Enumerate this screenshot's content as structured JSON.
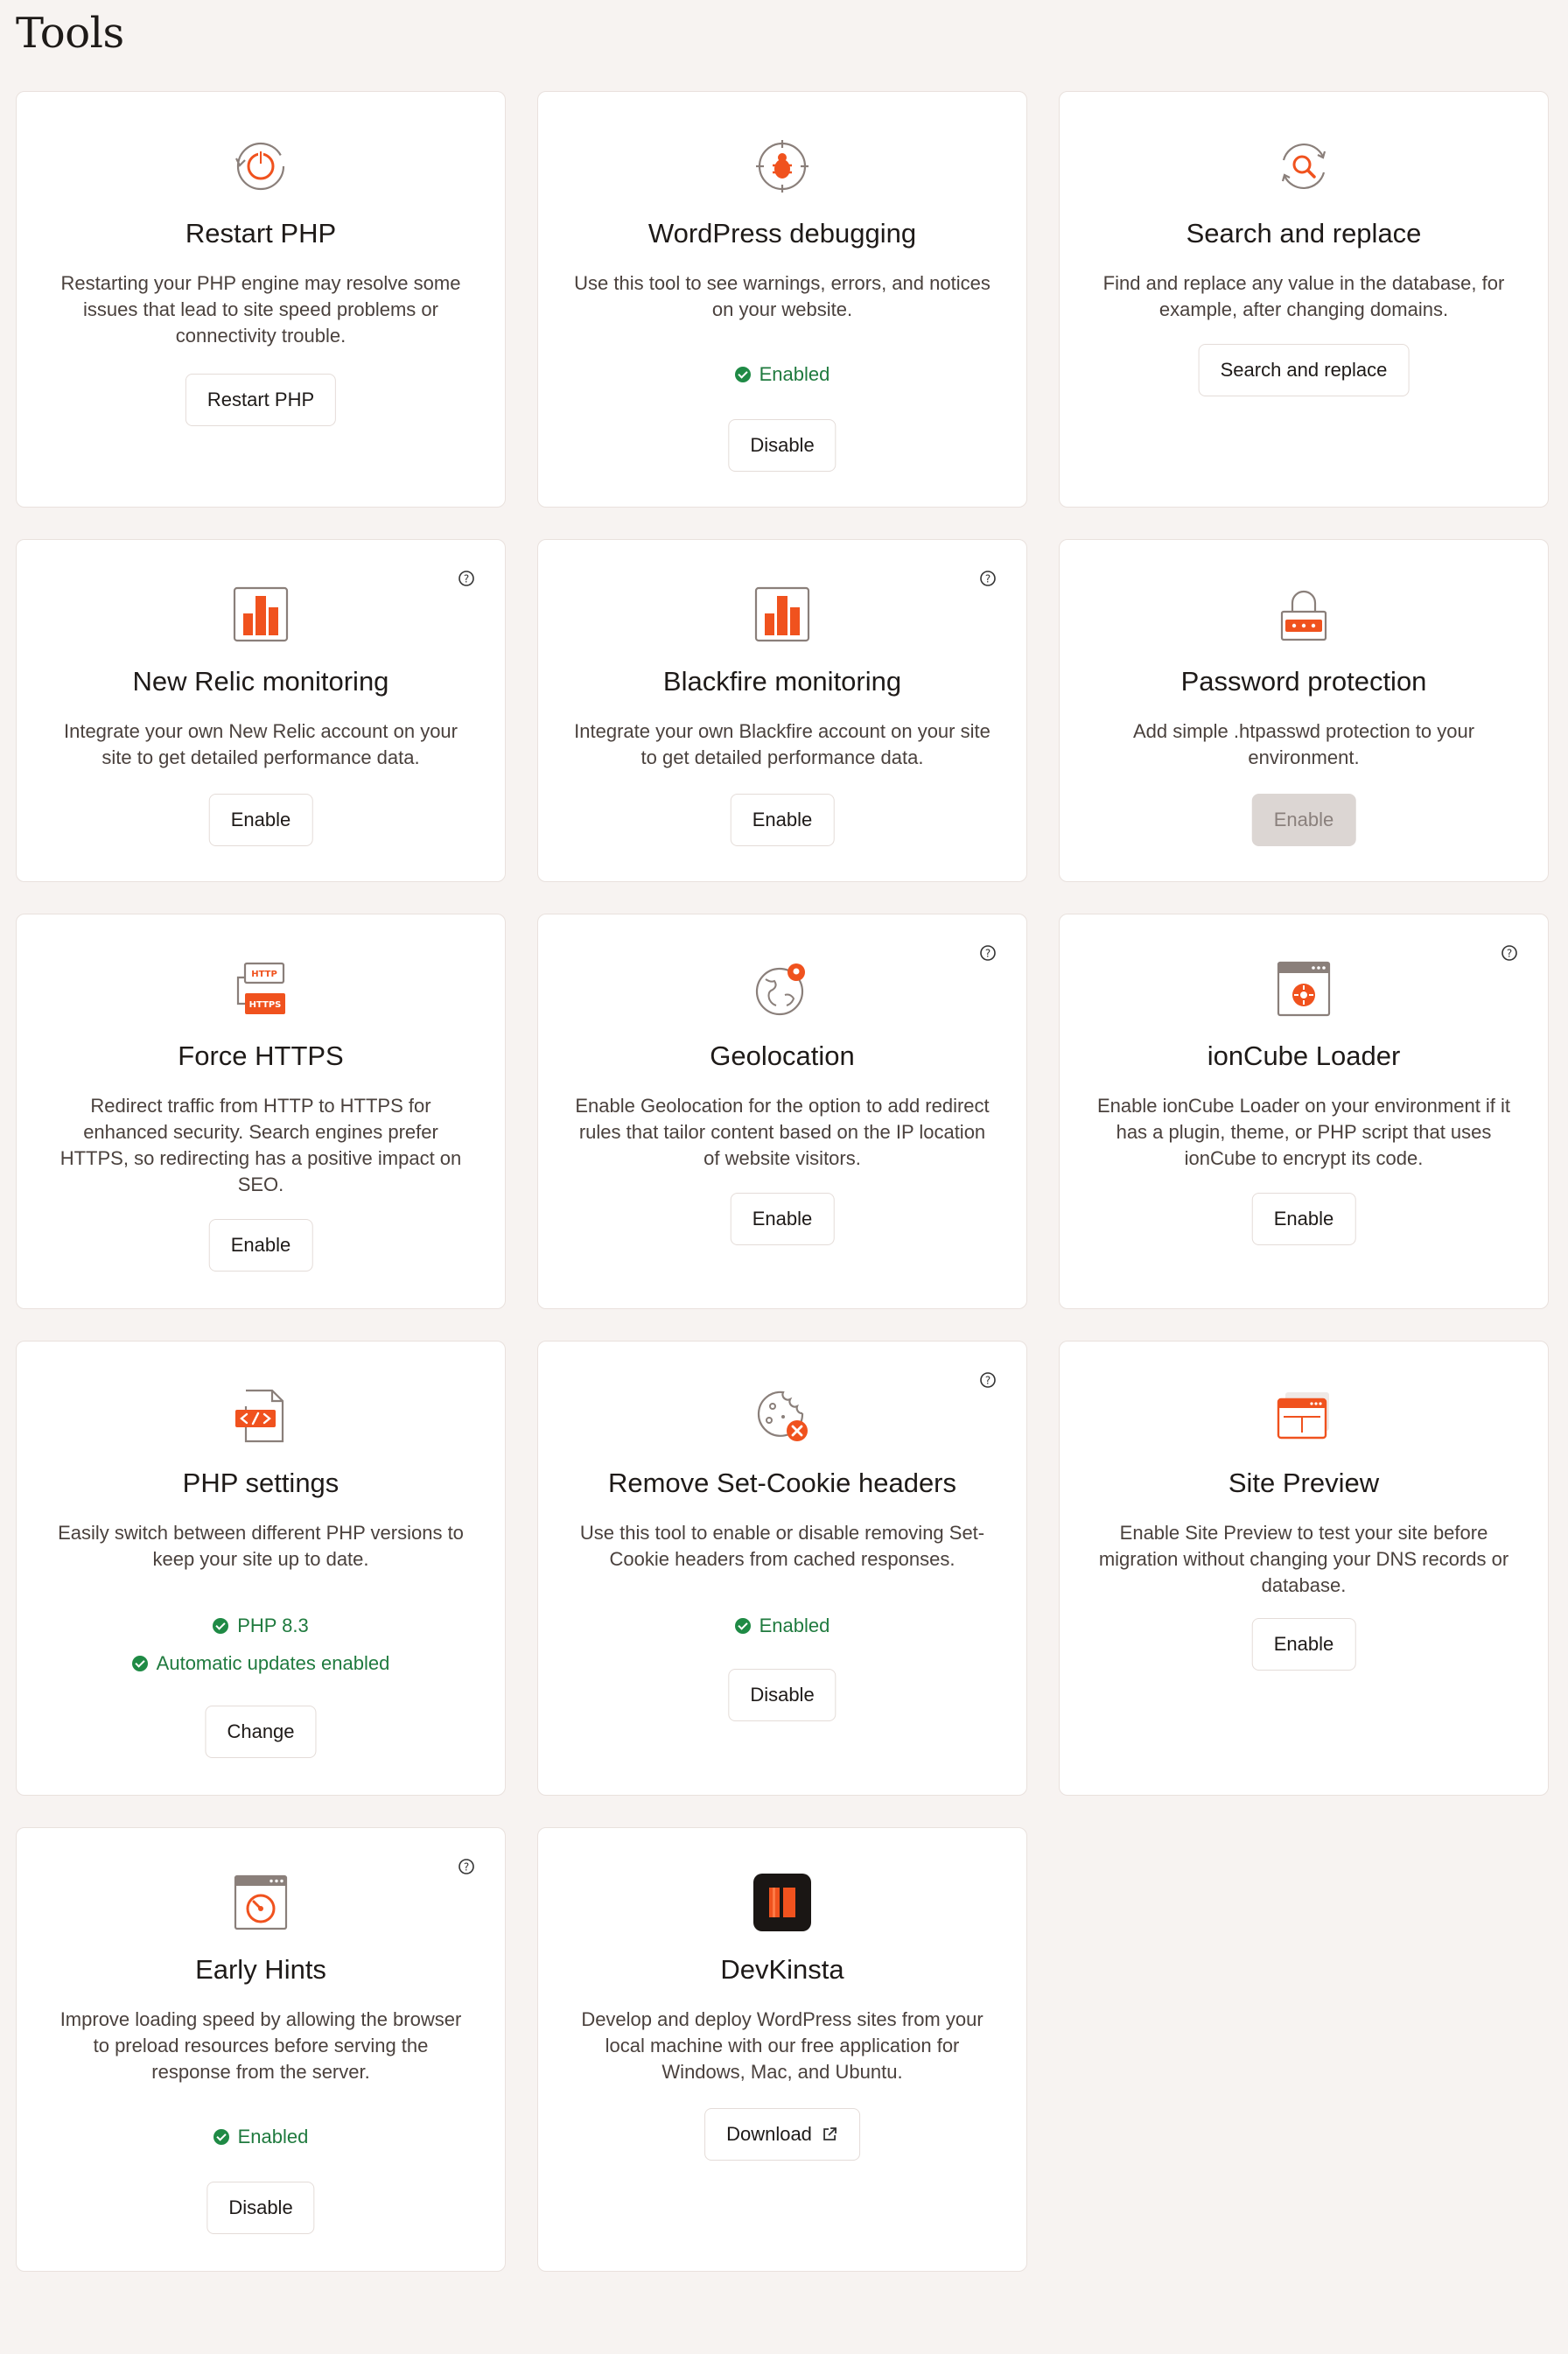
{
  "page": {
    "title": "Tools"
  },
  "colors": {
    "accent": "#f0521e",
    "success": "#1f8a45",
    "border": "#e9e1dd",
    "background": "#f7f3f1"
  },
  "cards": [
    {
      "title": "Restart PHP",
      "icon": "restart-power-icon",
      "description": "Restarting your PHP engine may resolve some issues that lead to site speed problems or connectivity trouble.",
      "button": "Restart PHP"
    },
    {
      "title": "WordPress debugging",
      "icon": "bug-icon",
      "description": "Use this tool to see warnings, errors, and notices on your website.",
      "status": [
        "Enabled"
      ],
      "button": "Disable"
    },
    {
      "title": "Search and replace",
      "icon": "search-replace-icon",
      "description": "Find and replace any value in the database, for example, after changing domains.",
      "button": "Search and replace"
    },
    {
      "title": "New Relic monitoring",
      "icon": "bar-chart-icon",
      "description": "Integrate your own New Relic account on your site to get detailed performance data.",
      "button": "Enable",
      "help": true
    },
    {
      "title": "Blackfire monitoring",
      "icon": "bar-chart-icon",
      "description": "Integrate your own Blackfire account on your site to get detailed performance data.",
      "button": "Enable",
      "help": true
    },
    {
      "title": "Password protection",
      "icon": "lock-icon",
      "description": "Add simple .htpasswd protection to your environment.",
      "button": "Enable",
      "disabled": true
    },
    {
      "title": "Force HTTPS",
      "icon": "https-icon",
      "icon_text": {
        "http": "HTTP",
        "https": "HTTPS"
      },
      "description": "Redirect traffic from HTTP to HTTPS for enhanced security. Search engines prefer HTTPS, so redirecting has a positive impact on SEO.",
      "button": "Enable"
    },
    {
      "title": "Geolocation",
      "icon": "globe-pin-icon",
      "description": "Enable Geolocation for the option to add redirect rules that tailor content based on the IP location of website visitors.",
      "button": "Enable",
      "help": true
    },
    {
      "title": "ionCube Loader",
      "icon": "browser-gear-icon",
      "description": "Enable ionCube Loader on your environment if it has a plugin, theme, or PHP script that uses ionCube to encrypt its code.",
      "button": "Enable",
      "help": true
    },
    {
      "title": "PHP settings",
      "icon": "code-file-icon",
      "description": "Easily switch between different PHP versions to keep your site up to date.",
      "status": [
        "PHP 8.3",
        "Automatic updates enabled"
      ],
      "button": "Change"
    },
    {
      "title": "Remove Set-Cookie headers",
      "icon": "cookie-remove-icon",
      "description": "Use this tool to enable or disable removing Set-Cookie headers from cached responses.",
      "status": [
        "Enabled"
      ],
      "button": "Disable",
      "help": true
    },
    {
      "title": "Site Preview",
      "icon": "browser-preview-icon",
      "description": "Enable Site Preview to test your site before migration without changing your DNS records or database.",
      "button": "Enable"
    },
    {
      "title": "Early Hints",
      "icon": "speedometer-icon",
      "description": "Improve loading speed by allowing the browser to preload resources before serving the response from the server.",
      "status": [
        "Enabled"
      ],
      "button": "Disable",
      "help": true
    },
    {
      "title": "DevKinsta",
      "icon": "devkinsta-logo-icon",
      "description": "Develop and deploy WordPress sites from your local machine with our free application for Windows, Mac, and Ubuntu.",
      "button": "Download",
      "external": true
    }
  ]
}
